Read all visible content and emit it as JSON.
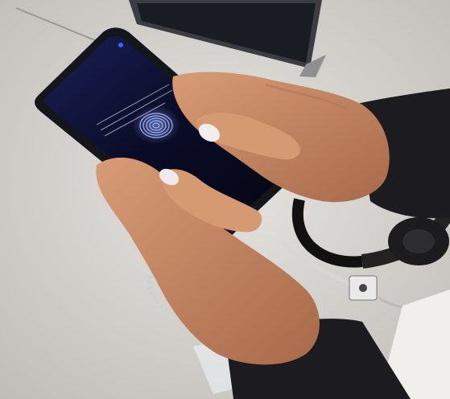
{
  "phone_screen": {
    "status_left": "",
    "status_time": "",
    "title": "",
    "hint": ""
  },
  "colors": {
    "table": "#d9d7d3",
    "phone_body": "#15161c",
    "screen": "#0b0d2a",
    "fingerprint": "#9fb4ff",
    "warning_text": "#ff4a4a",
    "sleeve": "#1b1b20",
    "skin": "#c98e6a"
  },
  "icons": [
    "fingerprint-icon",
    "settings-icon"
  ]
}
